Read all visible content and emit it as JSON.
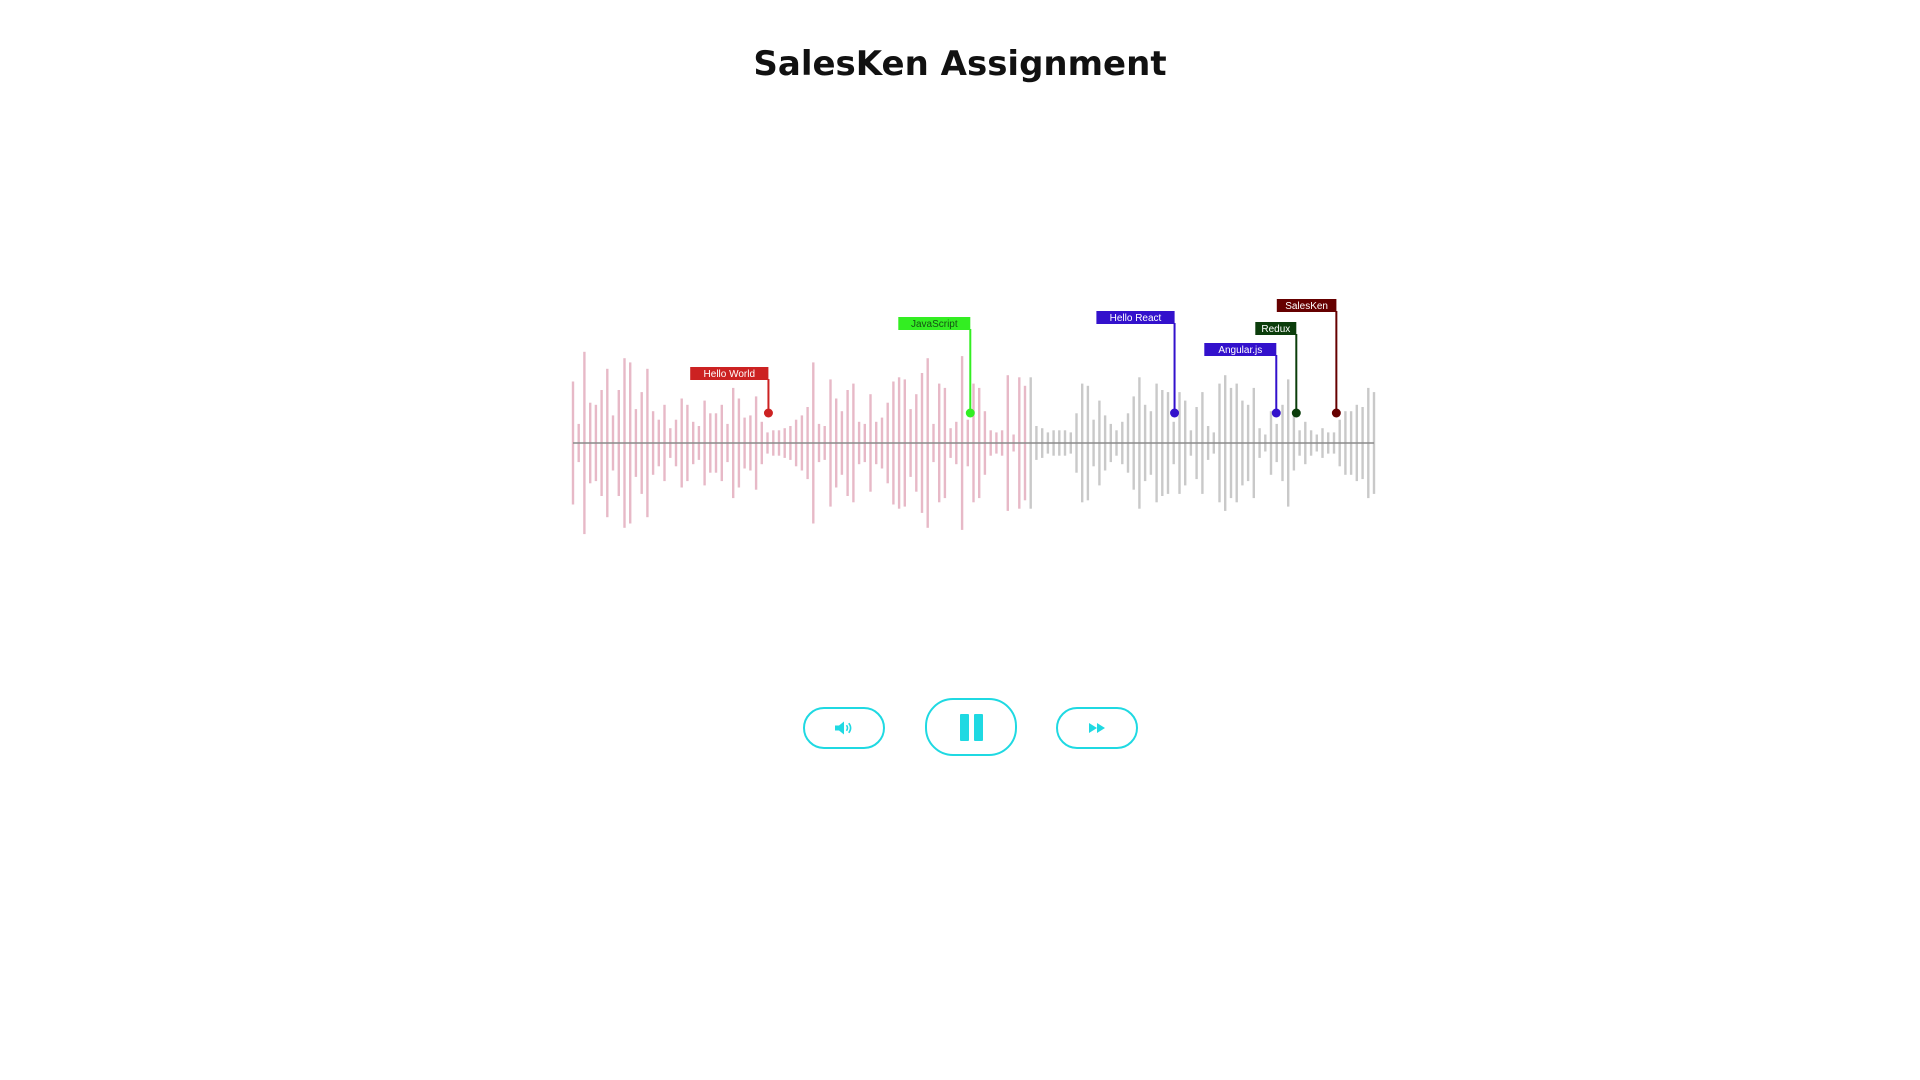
{
  "page": {
    "title": "SalesKen Assignment"
  },
  "colors": {
    "played_bar": "#e7b9c7",
    "unplayed_bar": "#c9c9c9",
    "baseline": "#8a8a8a",
    "control_accent": "#1fd9e2"
  },
  "waveform": {
    "bar_count": 150,
    "played_fraction": 0.57,
    "amplitudes": [
      0.58,
      0.18,
      0.86,
      0.38,
      0.36,
      0.5,
      0.7,
      0.26,
      0.5,
      0.8,
      0.76,
      0.32,
      0.48,
      0.7,
      0.3,
      0.22,
      0.36,
      0.14,
      0.22,
      0.42,
      0.36,
      0.2,
      0.16,
      0.4,
      0.28,
      0.28,
      0.36,
      0.18,
      0.52,
      0.42,
      0.24,
      0.26,
      0.44,
      0.2,
      0.1,
      0.12,
      0.12,
      0.14,
      0.16,
      0.22,
      0.26,
      0.34,
      0.76,
      0.18,
      0.16,
      0.6,
      0.42,
      0.3,
      0.5,
      0.56,
      0.2,
      0.18,
      0.46,
      0.2,
      0.24,
      0.38,
      0.58,
      0.62,
      0.6,
      0.32,
      0.46,
      0.66,
      0.8,
      0.18,
      0.56,
      0.52,
      0.14,
      0.2,
      0.82,
      0.22,
      0.56,
      0.52,
      0.3,
      0.12,
      0.1,
      0.12,
      0.64,
      0.08,
      0.62,
      0.54,
      0.62,
      0.16,
      0.14,
      0.1,
      0.12,
      0.12,
      0.12,
      0.1,
      0.28,
      0.56,
      0.54,
      0.22,
      0.4,
      0.26,
      0.18,
      0.12,
      0.2,
      0.28,
      0.44,
      0.62,
      0.36,
      0.3,
      0.56,
      0.5,
      0.48,
      0.2,
      0.48,
      0.4,
      0.12,
      0.34,
      0.48,
      0.16,
      0.1,
      0.56,
      0.64,
      0.52,
      0.56,
      0.4,
      0.36,
      0.52,
      0.14,
      0.08,
      0.3,
      0.18,
      0.36,
      0.6,
      0.26,
      0.12,
      0.2,
      0.12,
      0.08,
      0.14,
      0.1,
      0.1,
      0.22,
      0.3,
      0.3,
      0.36,
      0.34,
      0.52,
      0.48
    ],
    "markers": [
      {
        "label": "Hello World",
        "position": 0.244,
        "level": 0,
        "color": "#cc2222",
        "text_color": "#ffffff"
      },
      {
        "label": "JavaScript",
        "position": 0.496,
        "level": 1,
        "color": "#33ee22",
        "text_color": "#155015"
      },
      {
        "label": "Hello React",
        "position": 0.751,
        "level": 2,
        "color": "#3311cc",
        "text_color": "#ffffff"
      },
      {
        "label": "Angular.js",
        "position": 0.878,
        "level": 3,
        "color": "#3311cc",
        "text_color": "#ffffff"
      },
      {
        "label": "Redux",
        "position": 0.903,
        "level": 4,
        "color": "#0b3d0b",
        "text_color": "#ffffff"
      },
      {
        "label": "SalesKen",
        "position": 0.953,
        "level": 5,
        "color": "#660000",
        "text_color": "#ffffff"
      }
    ]
  },
  "controls": {
    "volume_icon": "volume-icon",
    "play_pause_icon": "pause-icon",
    "forward_icon": "fast-forward-icon"
  }
}
